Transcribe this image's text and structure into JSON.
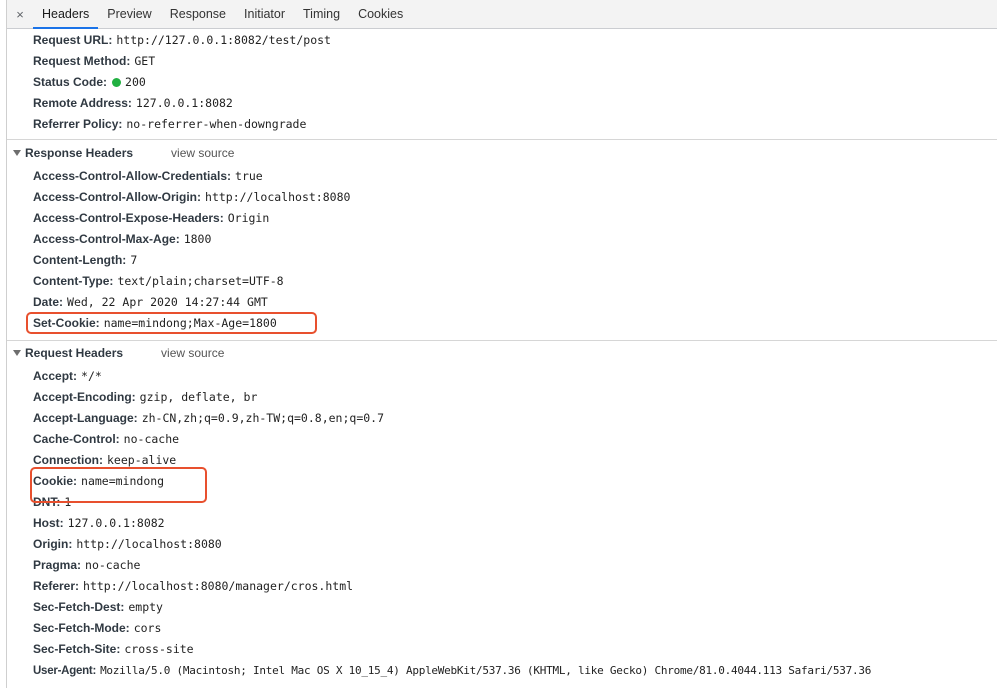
{
  "tabs": {
    "close": "×",
    "items": [
      "Headers",
      "Preview",
      "Response",
      "Initiator",
      "Timing",
      "Cookies"
    ]
  },
  "general": [
    {
      "key": "Request URL:",
      "value": "http://127.0.0.1:8082/test/post"
    },
    {
      "key": "Request Method:",
      "value": "GET"
    },
    {
      "key": "Status Code:",
      "value": "200"
    },
    {
      "key": "Remote Address:",
      "value": "127.0.0.1:8082"
    },
    {
      "key": "Referrer Policy:",
      "value": "no-referrer-when-downgrade"
    }
  ],
  "response_headers": {
    "title": "Response Headers",
    "view_source": "view source",
    "items": [
      {
        "key": "Access-Control-Allow-Credentials:",
        "value": "true"
      },
      {
        "key": "Access-Control-Allow-Origin:",
        "value": "http://localhost:8080"
      },
      {
        "key": "Access-Control-Expose-Headers:",
        "value": "Origin"
      },
      {
        "key": "Access-Control-Max-Age:",
        "value": "1800"
      },
      {
        "key": "Content-Length:",
        "value": "7"
      },
      {
        "key": "Content-Type:",
        "value": "text/plain;charset=UTF-8"
      },
      {
        "key": "Date:",
        "value": "Wed, 22 Apr 2020 14:27:44 GMT"
      },
      {
        "key": "Set-Cookie:",
        "value": "name=mindong;Max-Age=1800"
      }
    ]
  },
  "request_headers": {
    "title": "Request Headers",
    "view_source": "view source",
    "items": [
      {
        "key": "Accept:",
        "value": "*/*"
      },
      {
        "key": "Accept-Encoding:",
        "value": "gzip, deflate, br"
      },
      {
        "key": "Accept-Language:",
        "value": "zh-CN,zh;q=0.9,zh-TW;q=0.8,en;q=0.7"
      },
      {
        "key": "Cache-Control:",
        "value": "no-cache"
      },
      {
        "key": "Connection:",
        "value": "keep-alive"
      },
      {
        "key": "Cookie:",
        "value": "name=mindong"
      },
      {
        "key": "DNT:",
        "value": "1"
      },
      {
        "key": "Host:",
        "value": "127.0.0.1:8082"
      },
      {
        "key": "Origin:",
        "value": "http://localhost:8080"
      },
      {
        "key": "Pragma:",
        "value": "no-cache"
      },
      {
        "key": "Referer:",
        "value": "http://localhost:8080/manager/cros.html"
      },
      {
        "key": "Sec-Fetch-Dest:",
        "value": "empty"
      },
      {
        "key": "Sec-Fetch-Mode:",
        "value": "cors"
      },
      {
        "key": "Sec-Fetch-Site:",
        "value": "cross-site"
      },
      {
        "key": "User-Agent:",
        "value": "Mozilla/5.0 (Macintosh; Intel Mac OS X 10_15_4) AppleWebKit/537.36 (KHTML, like Gecko) Chrome/81.0.4044.113 Safari/537.36"
      }
    ]
  },
  "colors": {
    "status_ok": "#21b041",
    "active_tab_underline": "#1a73e8",
    "annotation_box": "#e8502e"
  }
}
